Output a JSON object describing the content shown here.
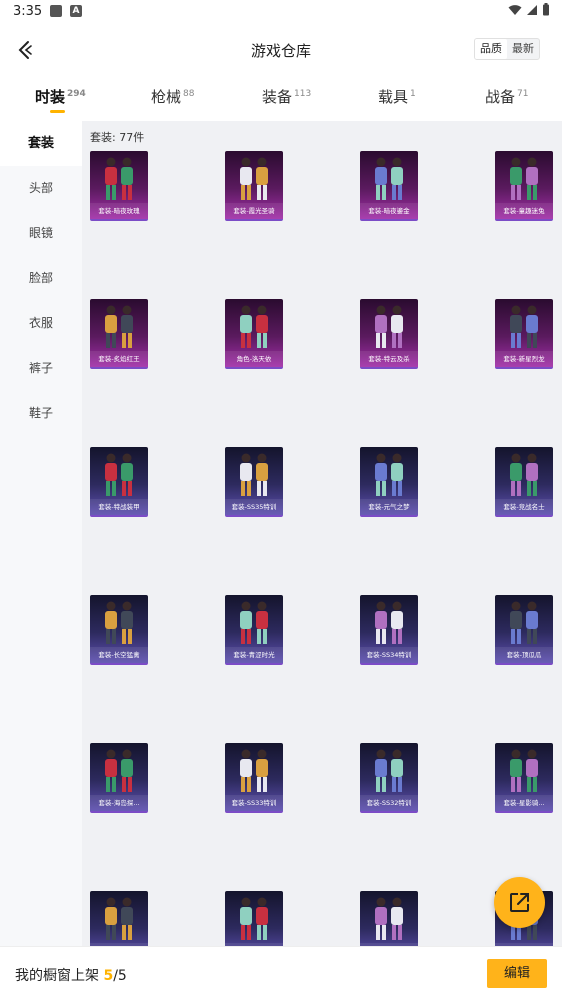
{
  "status": {
    "time": "3:35"
  },
  "header": {
    "title": "游戏仓库",
    "sort": [
      "品质",
      "最新"
    ],
    "sort_active": 0
  },
  "tabs": [
    {
      "label": "时装",
      "count": "294"
    },
    {
      "label": "枪械",
      "count": "88"
    },
    {
      "label": "装备",
      "count": "113"
    },
    {
      "label": "载具",
      "count": "1"
    },
    {
      "label": "战备",
      "count": "71"
    }
  ],
  "sidebar": [
    "套装",
    "头部",
    "眼镜",
    "脸部",
    "衣服",
    "裤子",
    "鞋子"
  ],
  "content": {
    "count_label": "套装: 77件"
  },
  "items": [
    {
      "label": "套装-暗夜玫瑰",
      "tier": "purple"
    },
    {
      "label": "套装-霞光圣骑",
      "tier": "purple"
    },
    {
      "label": "套装-暗夜鎏金",
      "tier": "purple"
    },
    {
      "label": "套装-童趣迷兔",
      "tier": "purple"
    },
    {
      "label": "套装-炙焰红王",
      "tier": "purple"
    },
    {
      "label": "角色-洛天依",
      "tier": "purple"
    },
    {
      "label": "套装-特云及杀",
      "tier": "purple"
    },
    {
      "label": "套装-新星烈龙",
      "tier": "purple"
    },
    {
      "label": "套装-特战装甲",
      "tier": "blue"
    },
    {
      "label": "套装-SS35特训",
      "tier": "blue"
    },
    {
      "label": "套装-元气之梦",
      "tier": "blue"
    },
    {
      "label": "套装-竞战名士",
      "tier": "blue"
    },
    {
      "label": "套装-长空猛禽",
      "tier": "blue"
    },
    {
      "label": "套装-青涩时光",
      "tier": "blue"
    },
    {
      "label": "套装-SS34特训",
      "tier": "blue"
    },
    {
      "label": "套装-顶瓜瓜",
      "tier": "blue"
    },
    {
      "label": "套装-海岛探...",
      "tier": "blue"
    },
    {
      "label": "套装-SS33特训",
      "tier": "blue"
    },
    {
      "label": "套装-SS32特训",
      "tier": "blue"
    },
    {
      "label": "套装-星影骑...",
      "tier": "blue"
    },
    {
      "label": "",
      "tier": "blue"
    },
    {
      "label": "",
      "tier": "blue"
    },
    {
      "label": "",
      "tier": "blue"
    },
    {
      "label": "",
      "tier": "blue"
    }
  ],
  "bottom": {
    "shelf_label": "我的橱窗上架",
    "shelf_current": "5",
    "shelf_sep": "/",
    "shelf_total": "5",
    "edit_label": "编辑"
  },
  "colors": {
    "accent": "#ffb31a",
    "purple_tier": "#a22fa8",
    "blue_tier": "#5d4fb0"
  }
}
